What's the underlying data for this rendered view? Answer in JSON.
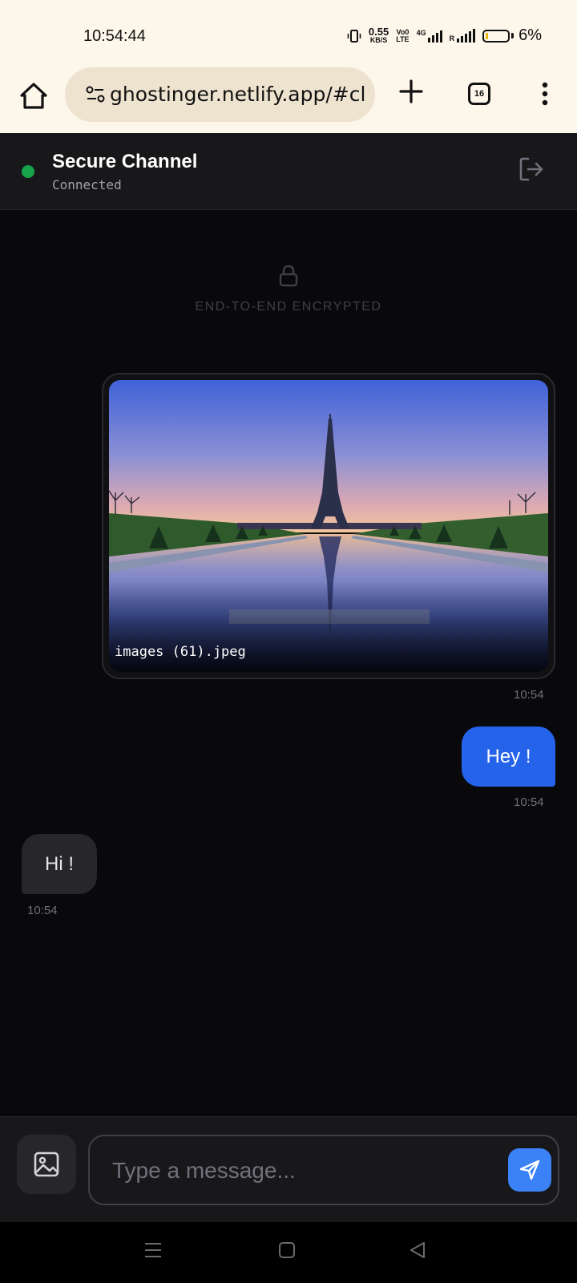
{
  "status_bar": {
    "time": "10:54:44",
    "speed_value": "0.55",
    "speed_unit": "KB/S",
    "volte_top": "Vo0",
    "volte_bottom": "LTE",
    "network_type": "4G",
    "roaming": "R",
    "battery_percent": "6%",
    "battery_level": 0.06
  },
  "browser": {
    "url": "ghostinger.netlify.app/#cl",
    "tab_count": "16",
    "icons": [
      "home-icon",
      "site-settings-icon",
      "plus-icon",
      "tabs-icon",
      "more-vert-icon"
    ]
  },
  "chat": {
    "title": "Secure Channel",
    "status": "Connected",
    "status_color": "#16a34a",
    "encryption_label": "END-TO-END ENCRYPTED",
    "image_message": {
      "filename": "images (61).jpeg",
      "time": "10:54"
    },
    "messages": [
      {
        "direction": "outgoing",
        "text": "Hey !",
        "time": "10:54"
      },
      {
        "direction": "incoming",
        "text": "Hi !",
        "time": "10:54"
      }
    ]
  },
  "composer": {
    "placeholder": "Type a message...",
    "accent": "#3b82f6"
  },
  "colors": {
    "outgoing_bubble": "#2563eb",
    "incoming_bubble": "#27272a",
    "background": "#09090b"
  }
}
